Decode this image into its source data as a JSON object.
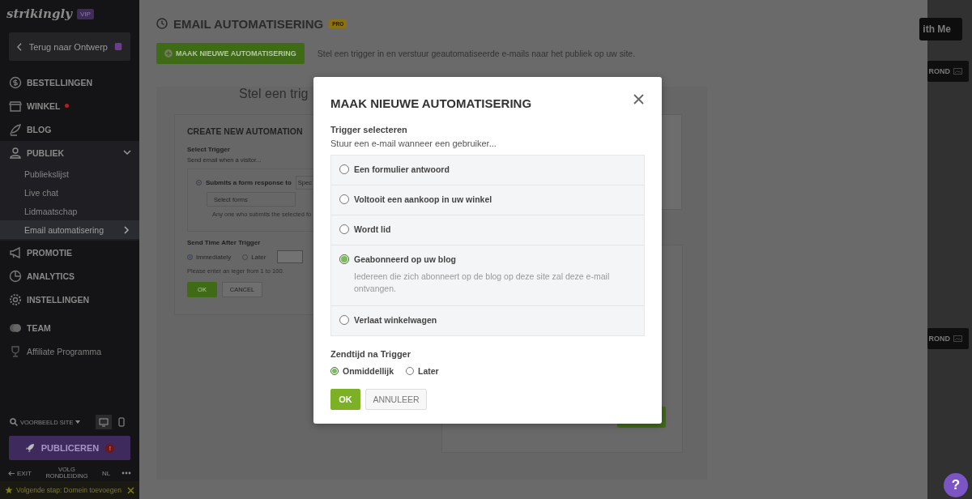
{
  "sidebar": {
    "logo": "strikingly",
    "logo_badge": "VIP",
    "back_button": "Terug naar Ontwerp",
    "items": [
      {
        "label": "BESTELLINGEN",
        "notification": false,
        "expanded": false
      },
      {
        "label": "WINKEL",
        "notification": true,
        "expanded": false
      },
      {
        "label": "BLOG",
        "notification": false,
        "expanded": false
      },
      {
        "label": "PUBLIEK",
        "notification": false,
        "expanded": true,
        "children": [
          {
            "label": "Publiekslijst",
            "selected": false
          },
          {
            "label": "Live chat",
            "selected": false
          },
          {
            "label": "Lidmaatschap",
            "selected": false
          },
          {
            "label": "Email automatisering",
            "selected": true
          }
        ]
      },
      {
        "label": "PROMOTIE",
        "notification": false,
        "expanded": false
      },
      {
        "label": "ANALYTICS",
        "notification": false,
        "expanded": false
      },
      {
        "label": "INSTELLINGEN",
        "notification": false,
        "expanded": false
      },
      {
        "label": "TEAM",
        "notification": false,
        "expanded": false
      },
      {
        "label": "Affiliate Programma",
        "notification": false,
        "expanded": false
      }
    ],
    "preview_site": "VOORBEELD SITE",
    "views": [
      {
        "kind": "desktop",
        "selected": true
      },
      {
        "kind": "mobile",
        "selected": false
      }
    ],
    "publish_button": "PUBLICEREN",
    "publish_alert": "!",
    "exit": "EXIT",
    "tour": "VOLG RONDLEIDING",
    "language": "NL",
    "next_step": "Volgende stap: Domein toevoegen"
  },
  "page": {
    "title": "EMAIL AUTOMATISERING",
    "badge": "PRO",
    "create_button": "MAAK NIEUWE AUTOMATISERING",
    "description": "Stel een trigger in en verstuur geautomatiseerde e-mails naar het publiek op uw site.",
    "panel_heading": "Stel een trig",
    "card": {
      "title": "CREATE NEW AUTOMATION",
      "trigger_label": "Select Trigger",
      "trigger_hint": "Send email when a visitor...",
      "option": {
        "label": "Submits a form response to",
        "selected": true
      },
      "option_dropdown": "Spec",
      "forms_placeholder": "Select forms",
      "forms_hint": "Any one who submits the selected fo",
      "send_time_label": "Send Time After Trigger",
      "send_times": [
        {
          "label": "Immediately",
          "selected": true
        },
        {
          "label": "Later",
          "selected": false
        }
      ],
      "send_time_hint": "Please enter an ieger  from 1 to 100.",
      "ok": "OK",
      "cancel": "CANCEL"
    }
  },
  "right_panel": {
    "button": "ith Me",
    "section_buttons": [
      "ROND",
      "ROND"
    ]
  },
  "help_button": "?",
  "modal": {
    "title": "MAAK NIEUWE AUTOMATISERING",
    "trigger_label": "Trigger selecteren",
    "trigger_hint": "Stuur een e-mail wanneer een gebruiker...",
    "options": [
      {
        "label": "Een formulier antwoord",
        "selected": false
      },
      {
        "label": "Voltooit een aankoop in uw winkel",
        "selected": false
      },
      {
        "label": "Wordt lid",
        "selected": false
      },
      {
        "label": "Geabonneerd op uw blog",
        "selected": true,
        "description": "Iedereen die zich abonneert op de blog op deze site zal deze e-mail ontvangen."
      },
      {
        "label": "Verlaat winkelwagen",
        "selected": false
      }
    ],
    "send_time_label": "Zendtijd na Trigger",
    "send_times": [
      {
        "label": "Onmiddellijk",
        "selected": true
      },
      {
        "label": "Later",
        "selected": false
      }
    ],
    "ok": "OK",
    "cancel": "ANNULEER"
  }
}
